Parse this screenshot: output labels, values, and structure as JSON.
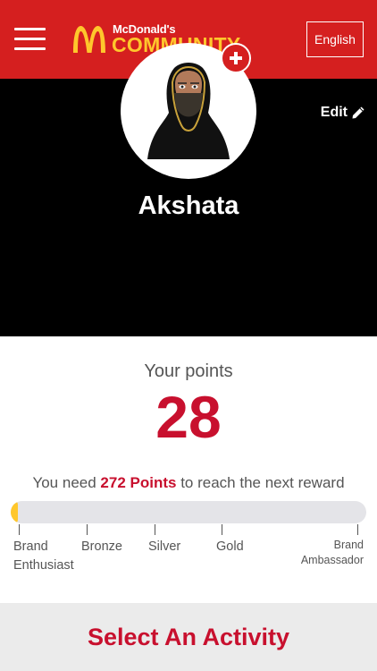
{
  "header": {
    "brand_top": "McDonald's",
    "brand_word": "COMMUNITY",
    "language_label": "English"
  },
  "profile": {
    "edit_label": "Edit",
    "username": "Akshata"
  },
  "points": {
    "label": "Your points",
    "value": "28",
    "need_prefix": "You need",
    "need_points": "272 Points",
    "need_suffix": "to reach the next reward",
    "progress_fraction": 0.02
  },
  "tiers": [
    {
      "line1": "Brand",
      "line2": "Enthusiast"
    },
    {
      "line1": "Bronze"
    },
    {
      "line1": "Silver"
    },
    {
      "line1": "Gold"
    },
    {
      "line1": "Brand",
      "line2": "Ambassador"
    }
  ],
  "footer": {
    "cta_label": "Select An Activity"
  },
  "colors": {
    "header_red": "#d51f1f",
    "accent_red": "#c8102e",
    "golden": "#ffc72c"
  }
}
